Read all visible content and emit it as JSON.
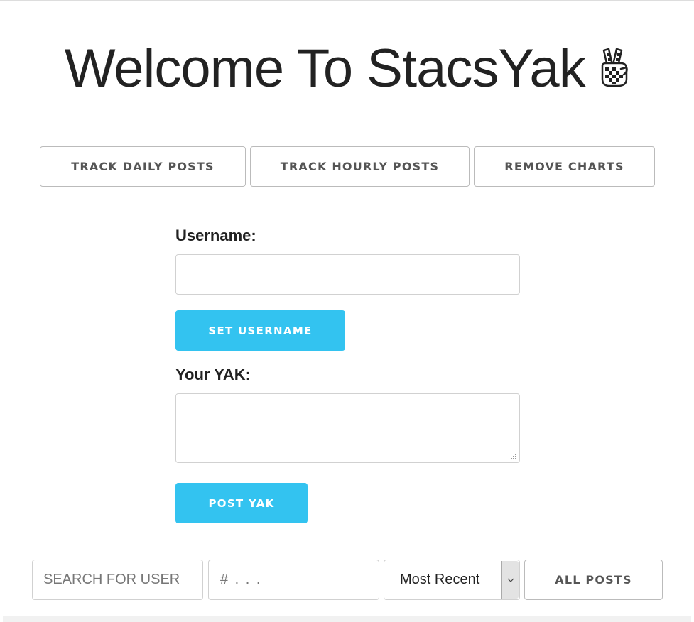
{
  "header": {
    "title": "Welcome To StacsYak",
    "icon": "peace-hand-icon"
  },
  "chart_controls": {
    "daily_label": "TRACK DAILY POSTS",
    "hourly_label": "TRACK HOURLY POSTS",
    "remove_label": "REMOVE CHARTS"
  },
  "form": {
    "username_label": "Username:",
    "username_value": "",
    "set_username_label": "SET USERNAME",
    "yak_label": "Your YAK:",
    "yak_value": "",
    "post_label": "POST YAK"
  },
  "filters": {
    "search_user_placeholder": "SEARCH FOR USER",
    "hashtag_placeholder": "# . . .",
    "sort_selected": "Most Recent",
    "all_posts_label": "ALL POSTS"
  },
  "colors": {
    "primary": "#33c3f0",
    "text": "#222222",
    "button_text": "#555555",
    "border": "#bbbbbb"
  }
}
